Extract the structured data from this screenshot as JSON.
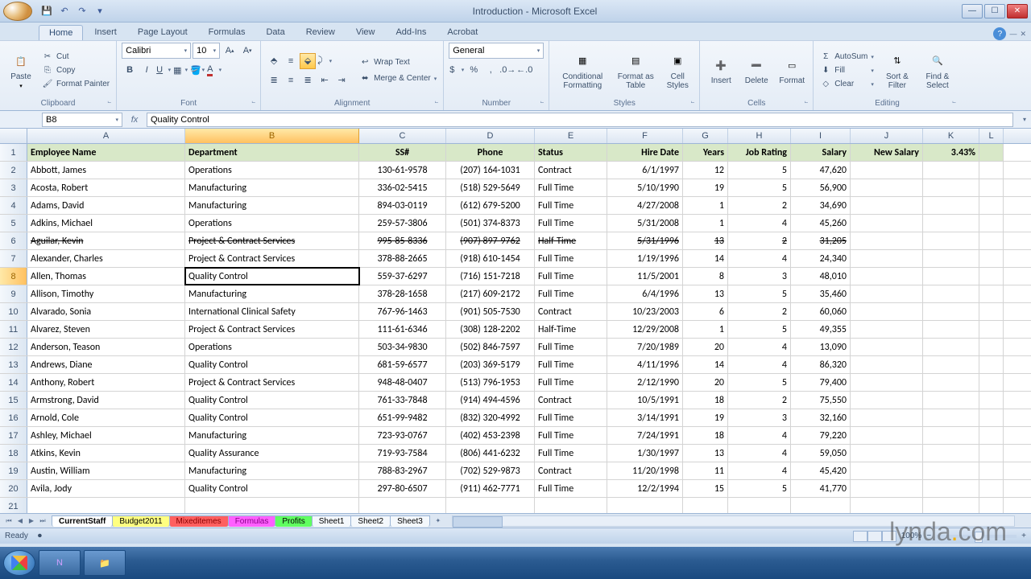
{
  "titlebar": {
    "title": "Introduction - Microsoft Excel"
  },
  "tabs": {
    "active": "Home",
    "items": [
      "Home",
      "Insert",
      "Page Layout",
      "Formulas",
      "Data",
      "Review",
      "View",
      "Add-Ins",
      "Acrobat"
    ]
  },
  "ribbon": {
    "clipboard": {
      "paste": "Paste",
      "cut": "Cut",
      "copy": "Copy",
      "format_painter": "Format Painter",
      "label": "Clipboard"
    },
    "font": {
      "name": "Calibri",
      "size": "10",
      "label": "Font"
    },
    "alignment": {
      "wrap": "Wrap Text",
      "merge": "Merge & Center",
      "label": "Alignment"
    },
    "number": {
      "format": "General",
      "label": "Number"
    },
    "styles": {
      "cond": "Conditional Formatting",
      "table": "Format as Table",
      "cell": "Cell Styles",
      "label": "Styles"
    },
    "cells": {
      "insert": "Insert",
      "delete": "Delete",
      "format": "Format",
      "label": "Cells"
    },
    "editing": {
      "sum": "AutoSum",
      "fill": "Fill",
      "clear": "Clear",
      "sort": "Sort & Filter",
      "find": "Find & Select",
      "label": "Editing"
    }
  },
  "fbar": {
    "ref": "B8",
    "formula": "Quality Control"
  },
  "columns": [
    "A",
    "B",
    "C",
    "D",
    "E",
    "F",
    "G",
    "H",
    "I",
    "J",
    "K",
    "L"
  ],
  "headers": [
    "Employee Name",
    "Department",
    "SS#",
    "Phone",
    "Status",
    "Hire Date",
    "Years",
    "Job Rating",
    "Salary",
    "New Salary",
    "3.43%"
  ],
  "rows": [
    [
      "Abbott, James",
      "Operations",
      "130-61-9578",
      "(207) 164-1031",
      "Contract",
      "6/1/1997",
      "12",
      "5",
      "47,620",
      "",
      ""
    ],
    [
      "Acosta, Robert",
      "Manufacturing",
      "336-02-5415",
      "(518) 529-5649",
      "Full Time",
      "5/10/1990",
      "19",
      "5",
      "56,900",
      "",
      ""
    ],
    [
      "Adams, David",
      "Manufacturing",
      "894-03-0119",
      "(612) 679-5200",
      "Full Time",
      "4/27/2008",
      "1",
      "2",
      "34,690",
      "",
      ""
    ],
    [
      "Adkins, Michael",
      "Operations",
      "259-57-3806",
      "(501) 374-8373",
      "Full Time",
      "5/31/2008",
      "1",
      "4",
      "45,260",
      "",
      ""
    ],
    [
      "Aguilar, Kevin",
      "Project & Contract Services",
      "995-85-8336",
      "(907) 897-9762",
      "Half-Time",
      "5/31/1996",
      "13",
      "2",
      "31,205",
      "",
      ""
    ],
    [
      "Alexander, Charles",
      "Project & Contract Services",
      "378-88-2665",
      "(918) 610-1454",
      "Full Time",
      "1/19/1996",
      "14",
      "4",
      "24,340",
      "",
      ""
    ],
    [
      "Allen, Thomas",
      "Quality Control",
      "559-37-6297",
      "(716) 151-7218",
      "Full Time",
      "11/5/2001",
      "8",
      "3",
      "48,010",
      "",
      ""
    ],
    [
      "Allison, Timothy",
      "Manufacturing",
      "378-28-1658",
      "(217) 609-2172",
      "Full Time",
      "6/4/1996",
      "13",
      "5",
      "35,460",
      "",
      ""
    ],
    [
      "Alvarado, Sonia",
      "International Clinical Safety",
      "767-96-1463",
      "(901) 505-7530",
      "Contract",
      "10/23/2003",
      "6",
      "2",
      "60,060",
      "",
      ""
    ],
    [
      "Alvarez, Steven",
      "Project & Contract Services",
      "111-61-6346",
      "(308) 128-2202",
      "Half-Time",
      "12/29/2008",
      "1",
      "5",
      "49,355",
      "",
      ""
    ],
    [
      "Anderson, Teason",
      "Operations",
      "503-34-9830",
      "(502) 846-7597",
      "Full Time",
      "7/20/1989",
      "20",
      "4",
      "13,090",
      "",
      ""
    ],
    [
      "Andrews, Diane",
      "Quality Control",
      "681-59-6577",
      "(203) 369-5179",
      "Full Time",
      "4/11/1996",
      "14",
      "4",
      "86,320",
      "",
      ""
    ],
    [
      "Anthony, Robert",
      "Project & Contract Services",
      "948-48-0407",
      "(513) 796-1953",
      "Full Time",
      "2/12/1990",
      "20",
      "5",
      "79,400",
      "",
      ""
    ],
    [
      "Armstrong, David",
      "Quality Control",
      "761-33-7848",
      "(914) 494-4596",
      "Contract",
      "10/5/1991",
      "18",
      "2",
      "75,550",
      "",
      ""
    ],
    [
      "Arnold, Cole",
      "Quality Control",
      "651-99-9482",
      "(832) 320-4992",
      "Full Time",
      "3/14/1991",
      "19",
      "3",
      "32,160",
      "",
      ""
    ],
    [
      "Ashley, Michael",
      "Manufacturing",
      "723-93-0767",
      "(402) 453-2398",
      "Full Time",
      "7/24/1991",
      "18",
      "4",
      "79,220",
      "",
      ""
    ],
    [
      "Atkins, Kevin",
      "Quality Assurance",
      "719-93-7584",
      "(806) 441-6232",
      "Full Time",
      "1/30/1997",
      "13",
      "4",
      "59,050",
      "",
      ""
    ],
    [
      "Austin, William",
      "Manufacturing",
      "788-83-2967",
      "(702) 529-9873",
      "Contract",
      "11/20/1998",
      "11",
      "4",
      "45,420",
      "",
      ""
    ],
    [
      "Avila, Jody",
      "Quality Control",
      "297-80-6507",
      "(911) 462-7771",
      "Full Time",
      "12/2/1994",
      "15",
      "5",
      "41,770",
      "",
      ""
    ]
  ],
  "selected": {
    "row": 8,
    "col": 1
  },
  "strike_row": 5,
  "sheets": {
    "items": [
      {
        "name": "CurrentStaff",
        "cls": "active"
      },
      {
        "name": "Budget2011",
        "cls": "yellow"
      },
      {
        "name": "Mixeditemes",
        "cls": "red"
      },
      {
        "name": "Formulas",
        "cls": "magenta"
      },
      {
        "name": "Profits",
        "cls": "green"
      },
      {
        "name": "Sheet1",
        "cls": ""
      },
      {
        "name": "Sheet2",
        "cls": ""
      },
      {
        "name": "Sheet3",
        "cls": ""
      }
    ]
  },
  "status": {
    "ready": "Ready",
    "zoom": "100%"
  },
  "watermark": {
    "brand": "lynda",
    "suffix": "com"
  }
}
